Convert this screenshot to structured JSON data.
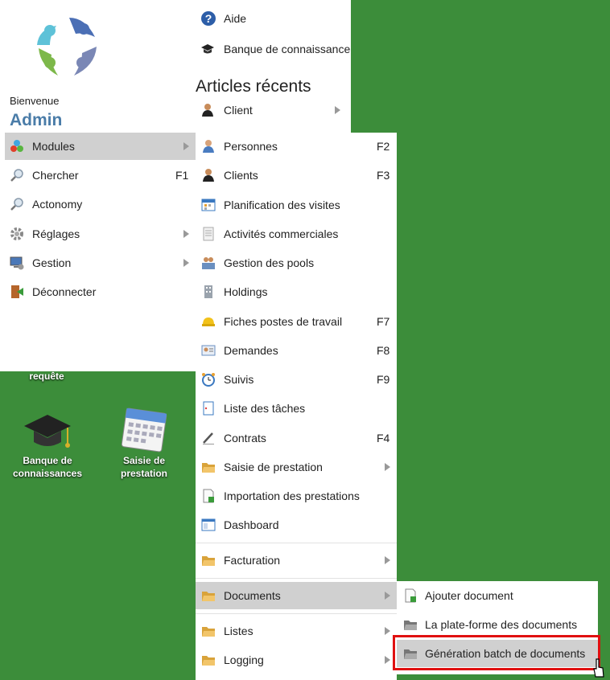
{
  "desktop": {
    "partial_label": "requête",
    "icons": [
      {
        "name": "graduation-cap-icon",
        "line1": "Banque de",
        "line2": "connaissances"
      },
      {
        "name": "calendar-icon",
        "line1": "Saisie de",
        "line2": "prestation"
      }
    ]
  },
  "user_panel": {
    "welcome": "Bienvenue",
    "username": "Admin"
  },
  "main_menu": [
    {
      "label": "Modules",
      "icon": "cubes-icon",
      "shortcut": "",
      "submenu": true
    },
    {
      "label": "Chercher",
      "icon": "search-icon",
      "shortcut": "F1",
      "submenu": false
    },
    {
      "label": "Actonomy",
      "icon": "search-icon",
      "shortcut": "",
      "submenu": false
    },
    {
      "label": "Réglages",
      "icon": "gear-icon",
      "shortcut": "",
      "submenu": true
    },
    {
      "label": "Gestion",
      "icon": "monitor-gear-icon",
      "shortcut": "",
      "submenu": true
    },
    {
      "label": "Déconnecter",
      "icon": "exit-door-icon",
      "shortcut": "",
      "submenu": false
    }
  ],
  "top_menu": {
    "help": "Aide",
    "knowledge": "Banque de connaissance",
    "recent_title": "Articles récents",
    "recent_client": "Client"
  },
  "modules_menu": [
    {
      "label": "Personnes",
      "icon": "person-icon",
      "shortcut": "F2"
    },
    {
      "label": "Clients",
      "icon": "client-icon",
      "shortcut": "F3"
    },
    {
      "label": "Planification des visites",
      "icon": "calendar-grid-icon",
      "shortcut": ""
    },
    {
      "label": "Activités commerciales",
      "icon": "document-lines-icon",
      "shortcut": ""
    },
    {
      "label": "Gestion des pools",
      "icon": "group-icon",
      "shortcut": ""
    },
    {
      "label": "Holdings",
      "icon": "building-icon",
      "shortcut": ""
    },
    {
      "label": "Fiches postes de travail",
      "icon": "hard-hat-icon",
      "shortcut": "F7"
    },
    {
      "label": "Demandes",
      "icon": "id-card-icon",
      "shortcut": "F8"
    },
    {
      "label": "Suivis",
      "icon": "alarm-clock-icon",
      "shortcut": "F9"
    },
    {
      "label": "Liste des tâches",
      "icon": "task-list-icon",
      "shortcut": ""
    },
    {
      "label": "Contrats",
      "icon": "pen-icon",
      "shortcut": "F4"
    },
    {
      "label": "Saisie de prestation",
      "icon": "folder-icon",
      "shortcut": ""
    },
    {
      "label": "Importation des prestations",
      "icon": "import-document-icon",
      "shortcut": ""
    },
    {
      "label": "Dashboard",
      "icon": "dashboard-icon",
      "shortcut": ""
    },
    {
      "label": "Facturation",
      "icon": "folder-icon",
      "shortcut": ""
    },
    {
      "label": "Documents",
      "icon": "folder-icon",
      "shortcut": ""
    },
    {
      "label": "Listes",
      "icon": "folder-icon",
      "shortcut": ""
    },
    {
      "label": "Logging",
      "icon": "folder-icon",
      "shortcut": ""
    }
  ],
  "documents_menu": [
    {
      "label": "Ajouter document",
      "icon": "add-document-icon"
    },
    {
      "label": "La plate-forme des documents",
      "icon": "folder-gray-icon"
    },
    {
      "label": "Génération batch de documents",
      "icon": "folder-gray-icon"
    }
  ],
  "colors": {
    "desktop": "#3c8d3a",
    "highlight": "#d0d0d0",
    "username": "#4a7ca8",
    "annotation": "#e01010"
  }
}
